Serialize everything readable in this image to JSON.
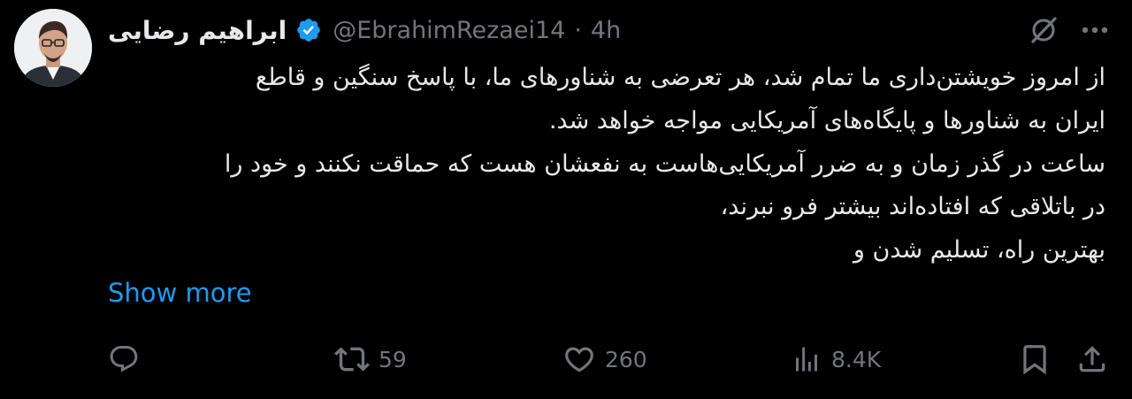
{
  "author": {
    "display_name": "ابراهیم رضایی",
    "handle": "@EbrahimRezaei14",
    "separator": "·",
    "time": "4h",
    "verified_badge": "verified-badge-icon"
  },
  "tweet": {
    "lines": [
      "از امروز خویشتن‌داری ما تمام شد، هر تعرضی به شناورهای ما، با پاسخ سنگین و قاطع",
      "ایران به شناورها و پایگاه‌های آمریکایی مواجه خواهد شد.",
      "ساعت در گذر زمان و به ضرر آمریکایی‌هاست به نفعشان هست که حماقت نکنند و خود را",
      "در باتلاقی که افتاده‌اند بیشتر فرو نبرند،",
      "بهترین راه، تسلیم شدن و"
    ],
    "show_more_label": "Show more"
  },
  "actions": {
    "reply_count": "",
    "retweet_count": "59",
    "like_count": "260",
    "views_count": "8.4K"
  },
  "icons": {
    "top": [
      "grok-icon",
      "more-icon"
    ],
    "bar": [
      "reply-icon",
      "retweet-icon",
      "like-icon",
      "views-icon",
      "bookmark-icon",
      "share-icon"
    ]
  },
  "colors": {
    "background": "#000000",
    "text": "#e7e9ea",
    "secondary": "#71767b",
    "link": "#1d9bf0",
    "verified": "#1d9bf0"
  }
}
